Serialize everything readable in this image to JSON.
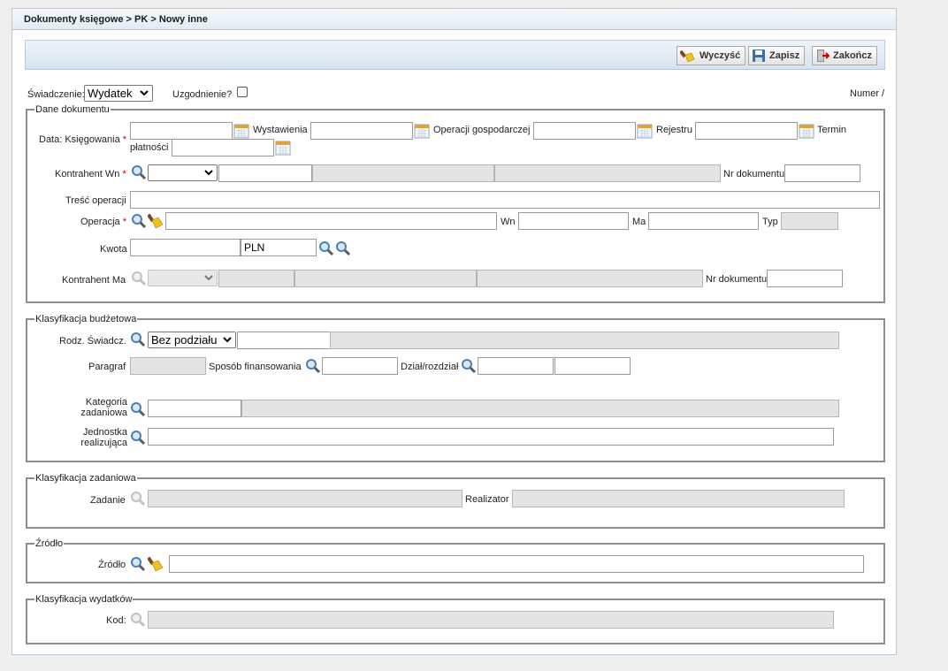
{
  "breadcrumb": "Dokumenty księgowe > PK > Nowy inne",
  "toolbar": {
    "clear_label": "Wyczyść",
    "save_label": "Zapisz",
    "close_label": "Zakończ"
  },
  "top": {
    "swiadczenie_label": "Świadczenie:",
    "swiadczenie_value": "Wydatek",
    "uzgodnienie_label": "Uzgodnienie?",
    "numer_label": "Numer /"
  },
  "dane": {
    "legend": "Dane dokumentu",
    "data_label": "Data: Księgowania",
    "wystawienia_label": "Wystawienia",
    "operacji_label": "Operacji gospodarczej",
    "rejestru_label": "Rejestru",
    "termin_label": "Termin",
    "platnosci_label": "płatności",
    "kontrahent_wn_label": "Kontrahent Wn",
    "nr_dokumentu_label": "Nr dokumentu",
    "tresc_label": "Treść operacji",
    "operacja_label": "Operacja",
    "wn_label": "Wn",
    "ma_label": "Ma",
    "typ_label": "Typ",
    "kwota_label": "Kwota",
    "currency_value": "PLN",
    "kontrahent_ma_label": "Kontrahent Ma",
    "nr_dokumentu2_label": "Nr dokumentu",
    "required_mark": "*"
  },
  "budzet": {
    "legend": "Klasyfikacja budżetowa",
    "rodz_label": "Rodz. Świadcz.",
    "rodz_value": "Bez podziału",
    "paragraf_label": "Paragraf",
    "sposob_label": "Sposób finansowania",
    "dzial_label": "Dział/rozdział",
    "kategoria_label_1": "Kategoria",
    "kategoria_label_2": "zadaniowa",
    "jednostka_label_1": "Jednostka",
    "jednostka_label_2": "realizująca"
  },
  "zadaniowa": {
    "legend": "Klasyfikacja zadaniowa",
    "zadanie_label": "Zadanie",
    "realizator_label": "Realizator"
  },
  "zrodlo": {
    "legend": "Źródło",
    "zrodlo_label": "Źródło"
  },
  "wydatki": {
    "legend": "Klasyfikacja wydatków",
    "kod_label": "Kod:"
  }
}
